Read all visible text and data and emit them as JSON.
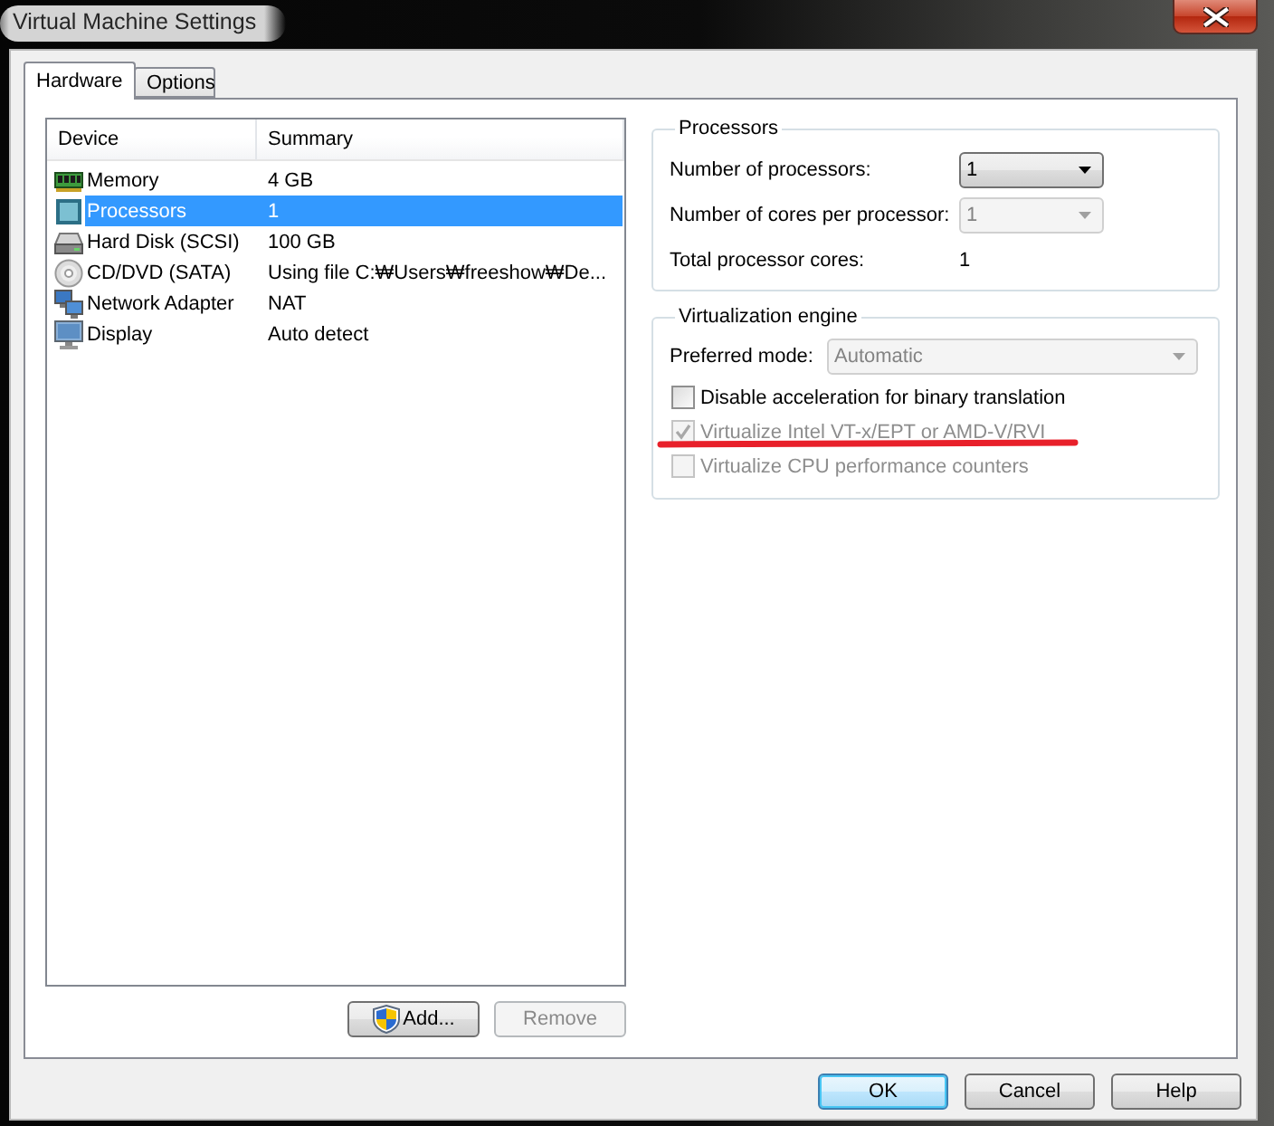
{
  "window": {
    "title": "Virtual Machine Settings"
  },
  "tabs": [
    {
      "label": "Hardware",
      "selected": true
    },
    {
      "label": "Options",
      "selected": false
    }
  ],
  "device_list": {
    "columns": [
      "Device",
      "Summary"
    ],
    "rows": [
      {
        "kind": "memory",
        "device": "Memory",
        "summary": "4 GB",
        "selected": false
      },
      {
        "kind": "processor",
        "device": "Processors",
        "summary": "1",
        "selected": true
      },
      {
        "kind": "harddisk",
        "device": "Hard Disk (SCSI)",
        "summary": "100 GB",
        "selected": false
      },
      {
        "kind": "cd",
        "device": "CD/DVD (SATA)",
        "summary": "Using file C:₩Users₩freeshow₩De...",
        "selected": false
      },
      {
        "kind": "network",
        "device": "Network Adapter",
        "summary": "NAT",
        "selected": false
      },
      {
        "kind": "display",
        "device": "Display",
        "summary": "Auto detect",
        "selected": false
      }
    ]
  },
  "device_buttons": [
    {
      "kind": "shield",
      "label": "Add...",
      "disabled": false
    },
    {
      "kind": "plain",
      "label": "Remove",
      "disabled": true
    }
  ],
  "processors": {
    "title": "Processors",
    "fields": [
      {
        "kind": "select",
        "label": "Number of processors:",
        "value": "1",
        "disabled": false
      },
      {
        "kind": "select",
        "label": "Number of cores per processor:",
        "value": "1",
        "disabled": true
      },
      {
        "kind": "text",
        "label": "Total processor cores:",
        "value": "1"
      }
    ]
  },
  "virtualization": {
    "title": "Virtualization engine",
    "preferred_mode": {
      "label": "Preferred mode:",
      "value": "Automatic",
      "disabled": true
    },
    "options": [
      {
        "label": "Disable acceleration for binary translation",
        "checked": false,
        "disabled": false,
        "annotated": false
      },
      {
        "label": "Virtualize Intel VT-x/EPT or AMD-V/RVI",
        "checked": true,
        "disabled": true,
        "annotated": true
      },
      {
        "label": "Virtualize CPU performance counters",
        "checked": false,
        "disabled": true,
        "annotated": false
      }
    ]
  },
  "footer_buttons": [
    {
      "label": "OK",
      "default": true
    },
    {
      "label": "Cancel",
      "default": false
    },
    {
      "label": "Help",
      "default": false
    }
  ]
}
